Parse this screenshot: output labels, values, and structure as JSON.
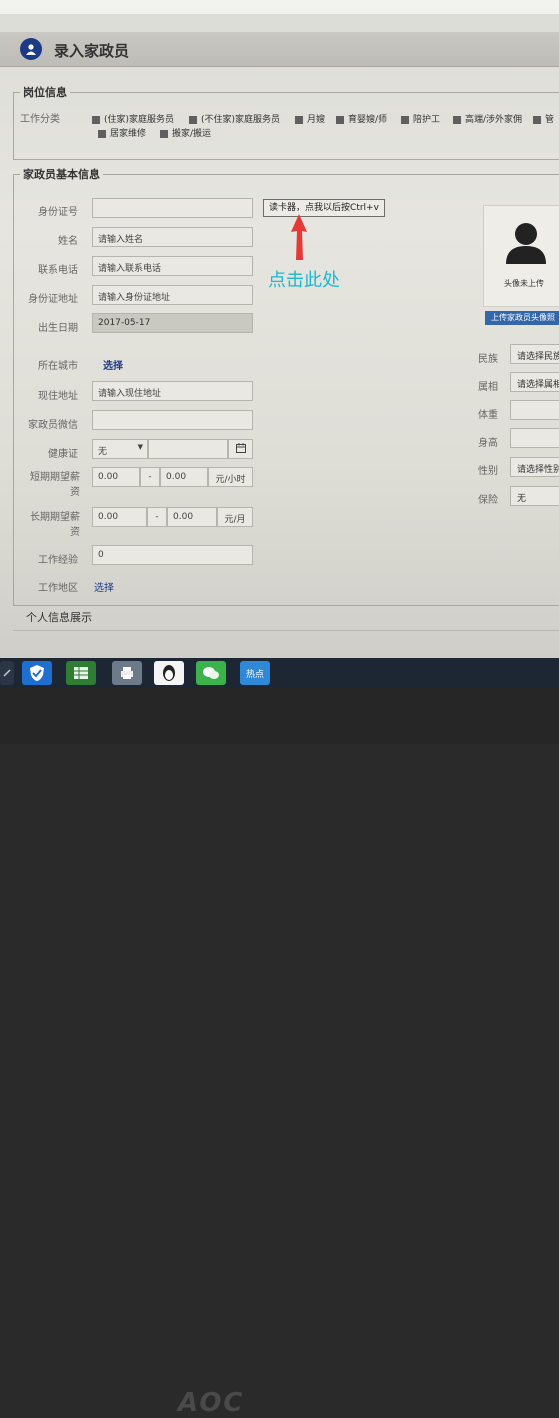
{
  "window": {
    "title": "录入家政员"
  },
  "job_section": {
    "legend": "岗位信息",
    "label": "工作分类",
    "categories_row1": [
      "(住家)家庭服务员",
      "(不住家)家庭服务员",
      "月嫂",
      "育婴嫂/师",
      "陪护工",
      "高端/涉外家佣",
      "管"
    ],
    "categories_row2": [
      "居家维修",
      "搬家/搬运"
    ]
  },
  "basic_section": {
    "legend": "家政员基本信息",
    "id_number": {
      "label": "身份证号",
      "value": ""
    },
    "read_card_button": "读卡器，点我以后按Ctrl+v",
    "annotation": "点击此处",
    "name": {
      "label": "姓名",
      "placeholder": "请输入姓名"
    },
    "phone": {
      "label": "联系电话",
      "placeholder": "请输入联系电话"
    },
    "id_address": {
      "label": "身份证地址",
      "placeholder": "请输入身份证地址"
    },
    "birth_date": {
      "label": "出生日期",
      "value": "2017-05-17"
    },
    "city": {
      "label": "所在城市",
      "link": "选择"
    },
    "current_address": {
      "label": "现住地址",
      "placeholder": "请输入现住地址"
    },
    "wechat": {
      "label": "家政员微信",
      "value": ""
    },
    "health_cert": {
      "label": "健康证",
      "value": "无"
    },
    "short_salary": {
      "label": "短期期望薪资",
      "min": "0.00",
      "max": "0.00",
      "unit": "元/小时",
      "sep": "-"
    },
    "long_salary": {
      "label": "长期期望薪资",
      "min": "0.00",
      "max": "0.00",
      "unit": "元/月",
      "sep": "-"
    },
    "experience": {
      "label": "工作经验",
      "value": "0"
    },
    "work_area": {
      "label": "工作地区",
      "link": "选择"
    }
  },
  "right_panel": {
    "avatar_caption": "头像未上传",
    "upload_button": "上传家政员头像照",
    "ethnicity": {
      "label": "民族",
      "value": "请选择民族"
    },
    "zodiac": {
      "label": "属相",
      "value": "请选择属相"
    },
    "weight": {
      "label": "体重",
      "value": ""
    },
    "height": {
      "label": "身高",
      "value": ""
    },
    "gender": {
      "label": "性别",
      "value": "请选择性别"
    },
    "insurance": {
      "label": "保险",
      "value": "无"
    }
  },
  "personal_section": {
    "legend": "个人信息展示"
  },
  "taskbar": {
    "news_label": "热点"
  },
  "monitor_brand": "AOC",
  "colors": {
    "accent": "#1d3a86",
    "annotation": "#19b8d4",
    "arrow": "#e53935",
    "upload": "#3366aa"
  }
}
